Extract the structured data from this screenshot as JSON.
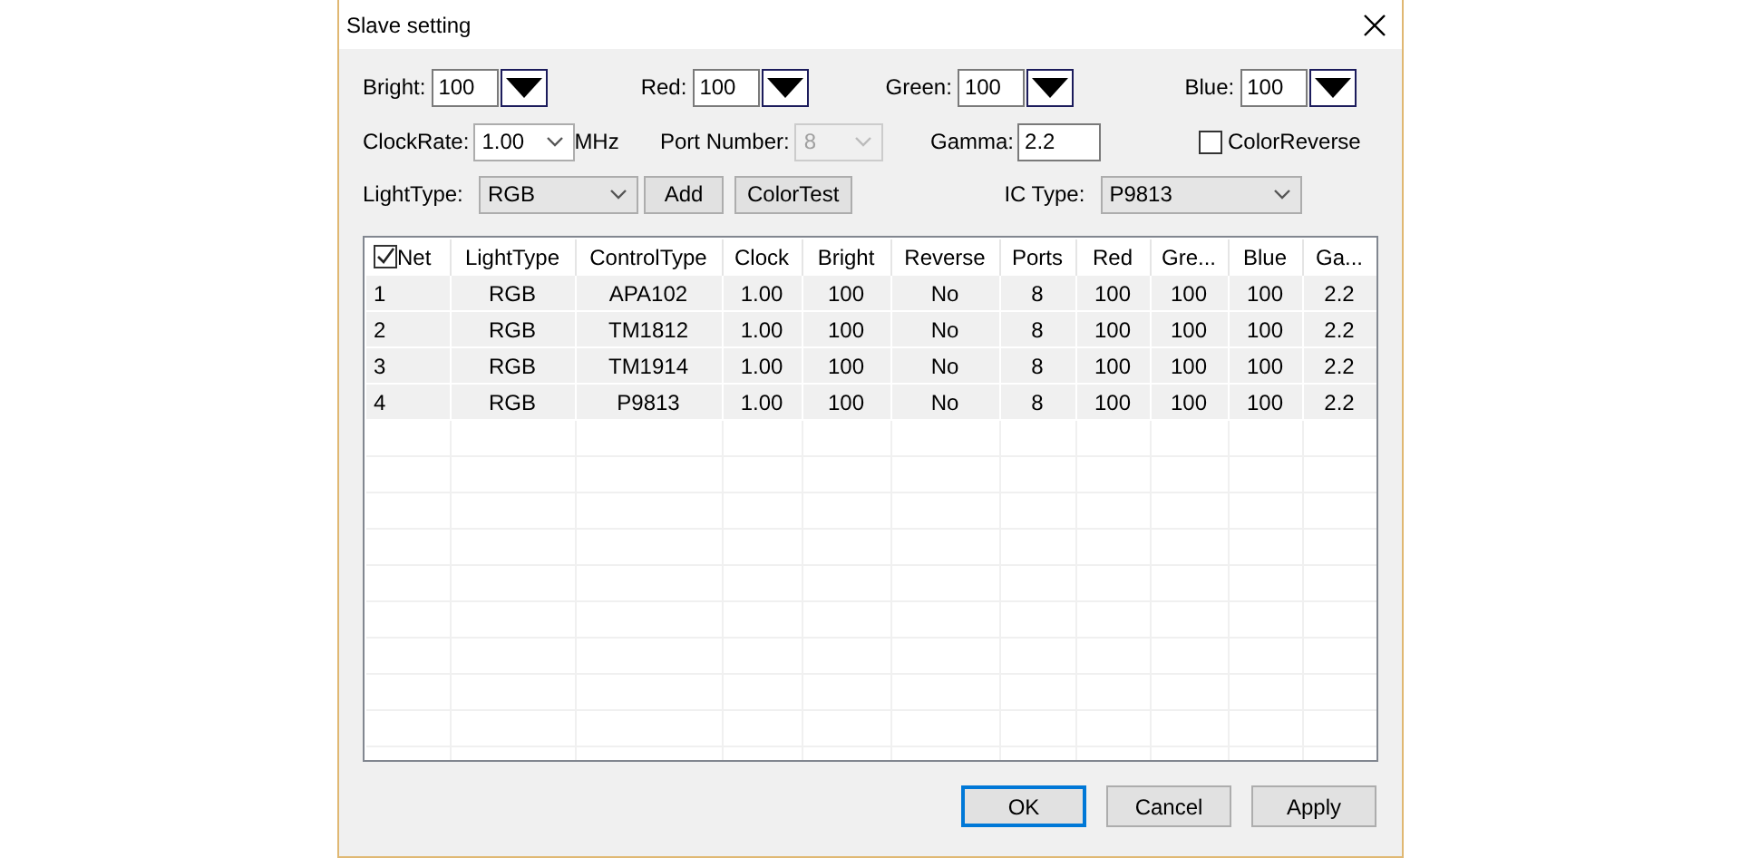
{
  "window": {
    "title": "Slave setting"
  },
  "levels": [
    {
      "label": "Bright:",
      "value": "100"
    },
    {
      "label": "Red:",
      "value": "100"
    },
    {
      "label": "Green:",
      "value": "100"
    },
    {
      "label": "Blue:",
      "value": "100"
    }
  ],
  "clock_rate": {
    "label": "ClockRate:",
    "value": "1.00",
    "unit": "MHz"
  },
  "port_number": {
    "label": "Port Number:",
    "value": "8",
    "disabled": true
  },
  "gamma": {
    "label": "Gamma:",
    "value": "2.2"
  },
  "color_reverse": {
    "label": "ColorReverse",
    "checked": false
  },
  "light_type": {
    "label": "LightType:",
    "value": "RGB"
  },
  "tool_buttons": [
    {
      "label": "Add"
    },
    {
      "label": "ColorTest"
    }
  ],
  "ic_type": {
    "label": "IC Type:",
    "value": "P9813"
  },
  "table": {
    "select_all_checked": true,
    "columns": [
      "Net",
      "LightType",
      "ControlType",
      "Clock",
      "Bright",
      "Reverse",
      "Ports",
      "Red",
      "Gre...",
      "Blue",
      "Ga..."
    ],
    "rows": [
      [
        "1",
        "RGB",
        "APA102",
        "1.00",
        "100",
        "No",
        "8",
        "100",
        "100",
        "100",
        "2.2"
      ],
      [
        "2",
        "RGB",
        "TM1812",
        "1.00",
        "100",
        "No",
        "8",
        "100",
        "100",
        "100",
        "2.2"
      ],
      [
        "3",
        "RGB",
        "TM1914",
        "1.00",
        "100",
        "No",
        "8",
        "100",
        "100",
        "100",
        "2.2"
      ],
      [
        "4",
        "RGB",
        "P9813",
        "1.00",
        "100",
        "No",
        "8",
        "100",
        "100",
        "100",
        "2.2"
      ]
    ]
  },
  "buttons": [
    {
      "label": "OK",
      "default": true
    },
    {
      "label": "Cancel",
      "default": false
    },
    {
      "label": "Apply",
      "default": false
    }
  ]
}
